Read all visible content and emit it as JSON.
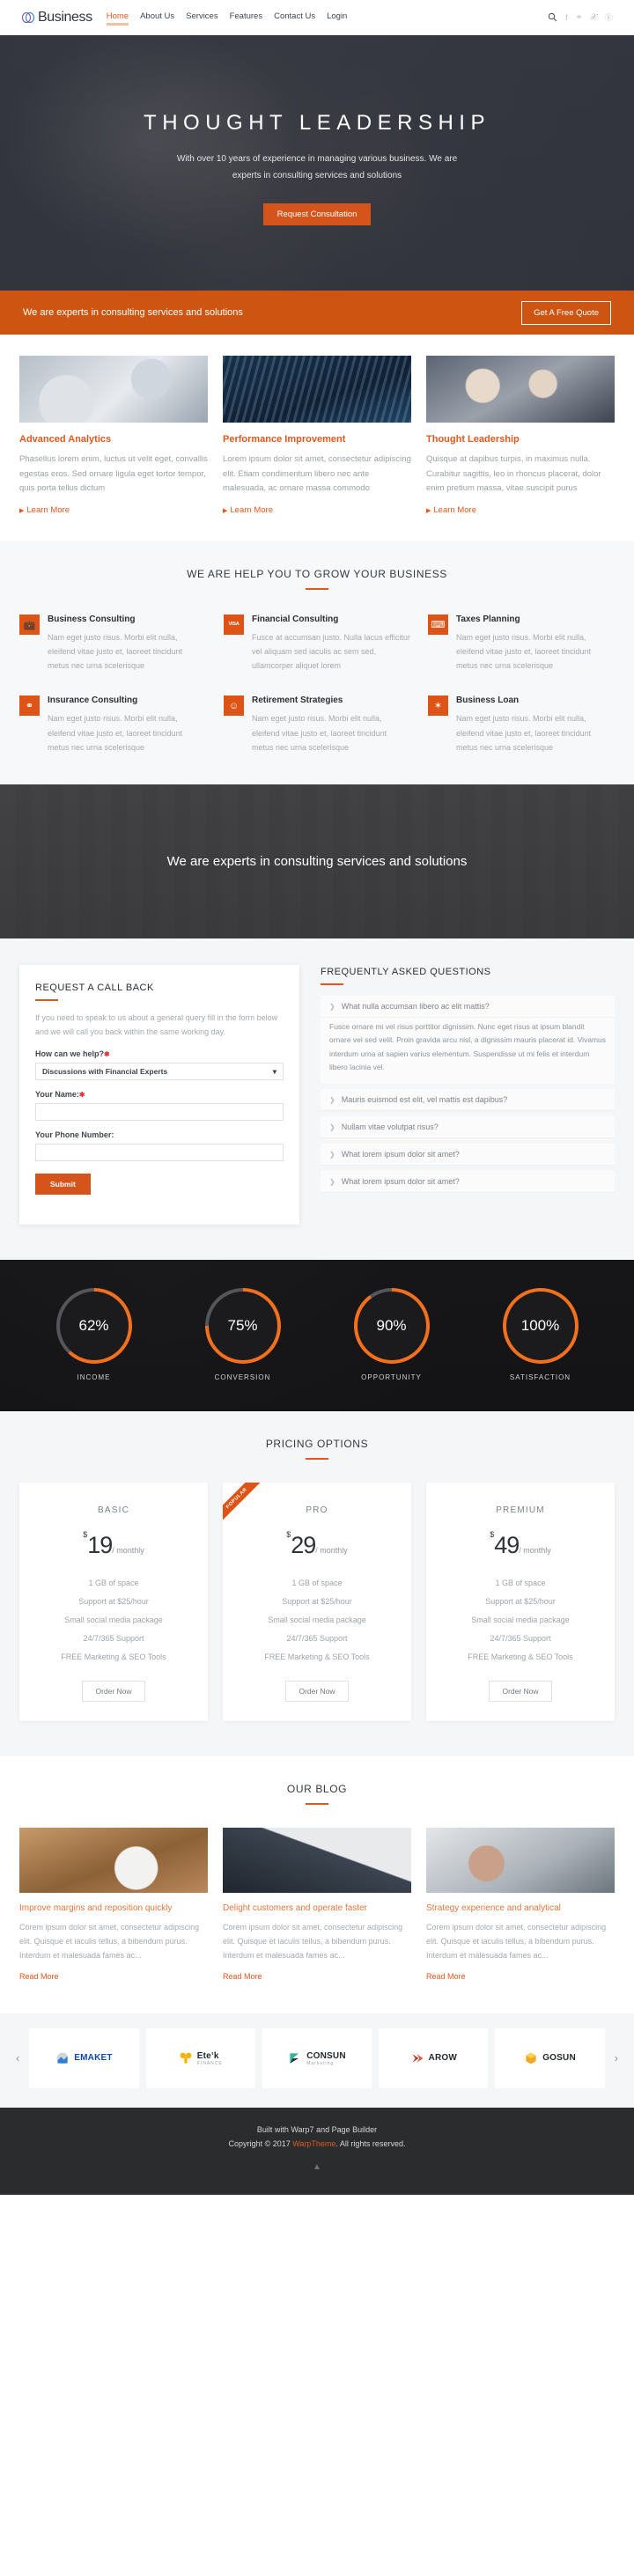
{
  "header": {
    "brand": "Business",
    "nav": [
      {
        "label": "Home",
        "active": true
      },
      {
        "label": "About Us",
        "active": false
      },
      {
        "label": "Services",
        "active": false
      },
      {
        "label": "Features",
        "active": false
      },
      {
        "label": "Contact Us",
        "active": false
      },
      {
        "label": "Login",
        "active": false
      }
    ],
    "icons": [
      "search-icon",
      "facebook-icon",
      "github-icon",
      "twitter-icon",
      "google-plus-icon"
    ],
    "social": [
      "f",
      "⌂",
      "ᴠ",
      "Ⓖ"
    ]
  },
  "hero": {
    "title": "THOUGHT LEADERSHIP",
    "subtitle": "With over 10 years of experience in managing various business. We are experts in consulting services and solutions",
    "button": "Request Consultation"
  },
  "cta": {
    "text": "We are experts in consulting services and solutions",
    "button": "Get A Free Quote"
  },
  "features": [
    {
      "title": "Advanced Analytics",
      "desc": "Phasellus lorem enim, luctus ut velit eget, convallis egestas eros. Sed ornare ligula eget tortor tempor, quis porta tellus dictum",
      "link": "Learn More"
    },
    {
      "title": "Performance Improvement",
      "desc": "Lorem ipsum dolor sit amet, consectetur adipiscing elit. Etiam condimentum libero nec ante malesuada, ac ornare massa commodo",
      "link": "Learn More"
    },
    {
      "title": "Thought Leadership",
      "desc": "Quisque at dapibus turpis, in maximus nulla. Curabitur sagittis, leo in rhoncus placerat, dolor enim pretium massa, vitae suscipit purus",
      "link": "Learn More"
    }
  ],
  "grow": {
    "title": "WE ARE HELP YOU TO GROW YOUR BUSINESS",
    "services": [
      {
        "icon": "briefcase-icon",
        "glyph": "💼",
        "title": "Business Consulting",
        "desc": "Nam eget justo risus. Morbi elit nulla, eleifend vitae justo et, laoreet tincidunt metus nec urna scelerisque"
      },
      {
        "icon": "visa-card-icon",
        "glyph": "VISA",
        "title": "Financial Consulting",
        "desc": "Fusce at accumsan justo. Nulla lacus efficitur vel aliquam sed iaculis ac sem sed, ullamcorper aliquet lorem"
      },
      {
        "icon": "calculator-icon",
        "glyph": "⌸",
        "title": "Taxes Planning",
        "desc": "Nam eget justo risus. Morbi elit nulla, eleifend vitae justo et, laoreet tincidunt metus nec urna scelerisque"
      },
      {
        "icon": "link-chain-icon",
        "glyph": "⚭",
        "title": "Insurance Consulting",
        "desc": "Nam eget justo risus. Morbi elit nulla, eleifend vitae justo et, laoreet tincidunt metus nec urna scelerisque"
      },
      {
        "icon": "smiley-face-icon",
        "glyph": "☺",
        "title": "Retirement Strategies",
        "desc": "Nam eget justo risus. Morbi elit nulla, eleifend vitae justo et, laoreet tincidunt metus nec urna scelerisque"
      },
      {
        "icon": "money-burst-icon",
        "glyph": "$",
        "title": "Business Loan",
        "desc": "Nam eget justo risus. Morbi elit nulla, eleifend vitae justo et, laoreet tincidunt metus nec urna scelerisque"
      }
    ]
  },
  "parallax": {
    "text": "We are experts in consulting services and solutions"
  },
  "callback": {
    "title": "REQUEST A CALL BACK",
    "desc": "If you need to speak to us about a general query fill in the form below and we will call you back within the same working day.",
    "help_label": "How can we help?",
    "help_value": "Discussions with Financial Experts",
    "name_label": "Your Name:",
    "name_value": "",
    "phone_label": "Your Phone Number:",
    "phone_value": "",
    "submit": "Submit"
  },
  "faq": {
    "title": "FREQUENTLY ASKED QUESTIONS",
    "items": [
      {
        "q": "What nulla accumsan libero ac elit mattis?",
        "a": "Fusce ornare mi vel risus porttitor dignissim. Nunc eget risus at ipsum blandit ornare vel sed velit. Proin gravida arcu nisl, a dignissim mauris placerat id. Vivamus interdum urna at sapien varius elementum. Suspendisse ut mi felis et interdum libero lacinia vel.",
        "open": true
      },
      {
        "q": "Mauris euismod est elit, vel mattis est dapibus?",
        "a": "",
        "open": false
      },
      {
        "q": "Nullam vitae volutpat risus?",
        "a": "",
        "open": false
      },
      {
        "q": "What lorem ipsum dolor sit amet?",
        "a": "",
        "open": false
      },
      {
        "q": "What lorem ipsum dolor sit amet?",
        "a": "",
        "open": false
      }
    ]
  },
  "stats": [
    {
      "value": "62%",
      "percent": 62,
      "label": "INCOME"
    },
    {
      "value": "75%",
      "percent": 75,
      "label": "CONVERSION"
    },
    {
      "value": "90%",
      "percent": 90,
      "label": "OPPORTUNITY"
    },
    {
      "value": "100%",
      "percent": 100,
      "label": "SATISFACTION"
    }
  ],
  "pricing": {
    "title": "PRICING OPTIONS",
    "plans": [
      {
        "name": "BASIC",
        "currency": "$",
        "amount": "19",
        "period": "/ monthly",
        "popular": "",
        "features": [
          "1 GB of space",
          "Support at $25/hour",
          "Small social media package",
          "24/7/365 Support",
          "FREE Marketing & SEO Tools"
        ],
        "button": "Order Now"
      },
      {
        "name": "PRO",
        "currency": "$",
        "amount": "29",
        "period": "/ monthly",
        "popular": "POPULAR",
        "features": [
          "1 GB of space",
          "Support at $25/hour",
          "Small social media package",
          "24/7/365 Support",
          "FREE Marketing & SEO Tools"
        ],
        "button": "Order Now"
      },
      {
        "name": "PREMIUM",
        "currency": "$",
        "amount": "49",
        "period": "/ monthly",
        "popular": "",
        "features": [
          "1 GB of space",
          "Support at $25/hour",
          "Small social media package",
          "24/7/365 Support",
          "FREE Marketing & SEO Tools"
        ],
        "button": "Order Now"
      }
    ]
  },
  "blog": {
    "title": "OUR BLOG",
    "posts": [
      {
        "title": "Improve margins and reposition quickly",
        "desc": "Corem ipsum dolor sit amet, consectetur adipiscing elit. Quisque et iaculis tellus, a bibendum purus. Interdum et malesuada fames ac...",
        "link": "Read More"
      },
      {
        "title": "Delight customers and operate faster",
        "desc": "Corem ipsum dolor sit amet, consectetur adipiscing elit. Quisque et iaculis tellus, a bibendum purus. Interdum et malesuada fames ac...",
        "link": "Read More"
      },
      {
        "title": "Strategy experience and analytical",
        "desc": "Corem ipsum dolor sit amet, consectetur adipiscing elit. Quisque et iaculis tellus, a bibendum purus. Interdum et malesuada fames ac...",
        "link": "Read More"
      }
    ]
  },
  "logos": {
    "prev": "‹",
    "next": "›",
    "items": [
      {
        "name": "EMAKET",
        "sub": "",
        "style": "blue"
      },
      {
        "name": "Eteʼk",
        "sub": "FINANCE",
        "style": "dark"
      },
      {
        "name": "CONSUN",
        "sub": "Marketing",
        "style": "dark"
      },
      {
        "name": "AROW",
        "sub": "",
        "style": "dark"
      },
      {
        "name": "GOSUN",
        "sub": "",
        "style": "dark"
      }
    ]
  },
  "footer": {
    "line1": "Built with Warp7 and Page Builder",
    "copy_prefix": "Copyright © 2017 ",
    "copy_link": "WarpTheme",
    "copy_suffix": ". All rights reserved.",
    "to_top": "▲"
  },
  "colors": {
    "accent": "#e2571e",
    "cta_bg": "#ce5411",
    "icon_bg": "#dd5416",
    "dark": "#2b2c2e"
  }
}
